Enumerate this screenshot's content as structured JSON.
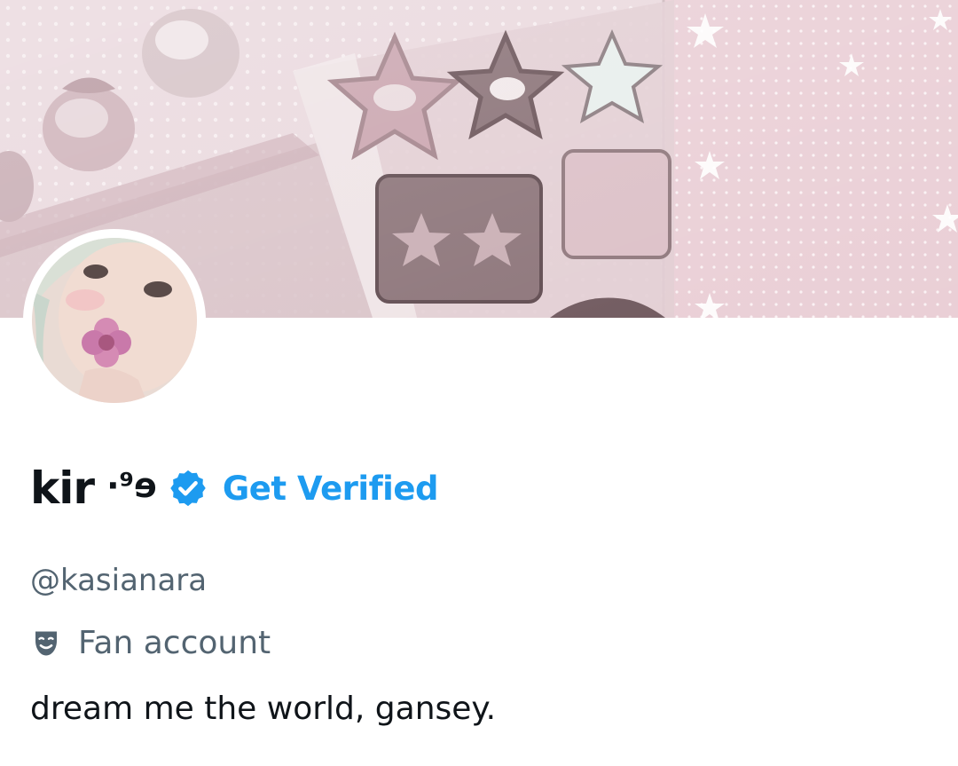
{
  "profile": {
    "display_name": "kir",
    "name_decoration": "·⁹ɘ",
    "verified_badge": "verified-badge-icon",
    "get_verified_label": "Get Verified",
    "handle": "@kasianara",
    "category_icon": "theater-masks-icon",
    "category_label": "Fan account",
    "bio": "dream me the world, gansey."
  },
  "colors": {
    "text_primary": "#0f1419",
    "text_secondary": "#536471",
    "accent": "#1d9bf0",
    "banner_pink": "#e7d5da"
  }
}
